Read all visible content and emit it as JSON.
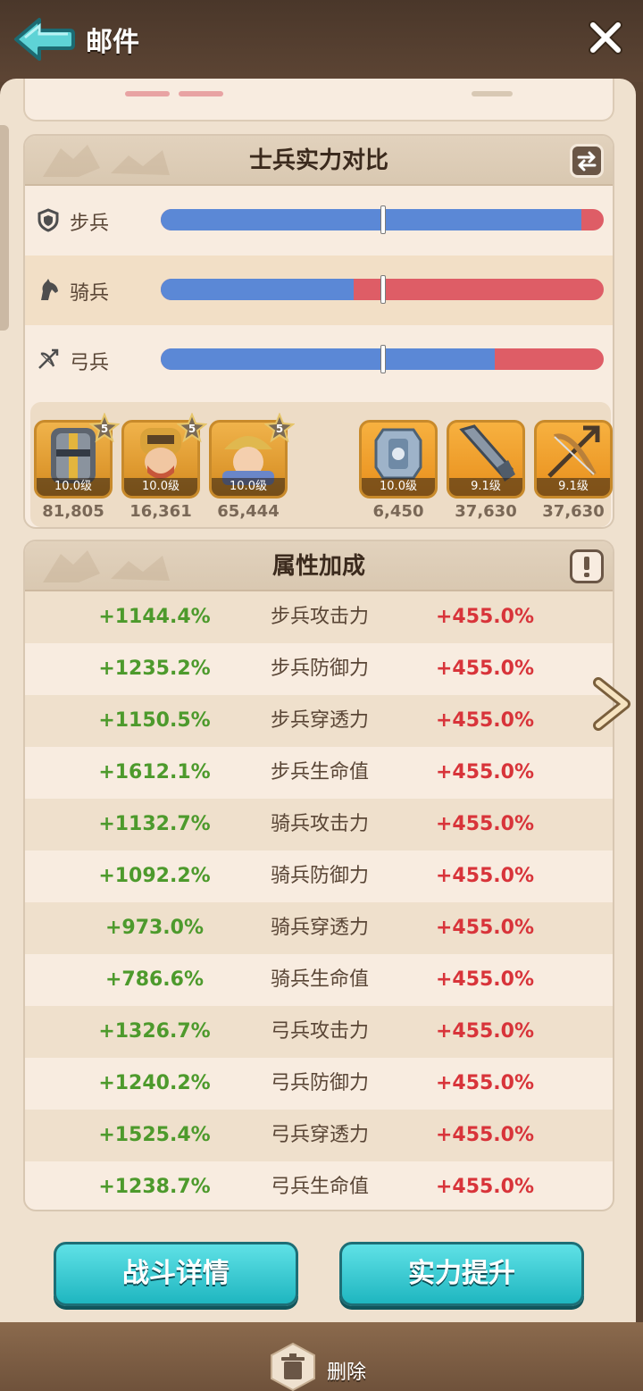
{
  "header": {
    "title": "邮件"
  },
  "comparison": {
    "title": "士兵实力对比",
    "rows": [
      {
        "label": "步兵",
        "icon": "shield-icon",
        "ratio": 0.95
      },
      {
        "label": "骑兵",
        "icon": "horse-icon",
        "ratio": 0.435
      },
      {
        "label": "弓兵",
        "icon": "crossbow-icon",
        "ratio": 0.755
      }
    ]
  },
  "units": [
    {
      "level": "10.0级",
      "stars": "5",
      "value": "81,805",
      "icon": "knight-helmet-portrait"
    },
    {
      "level": "10.0级",
      "stars": "5",
      "value": "16,361",
      "icon": "bearded-warrior-portrait"
    },
    {
      "level": "10.0级",
      "stars": "5",
      "value": "65,444",
      "icon": "young-soldier-portrait"
    },
    {
      "level": "10.0级",
      "value": "6,450",
      "icon": "shield-item-icon"
    },
    {
      "level": "9.1级",
      "value": "37,630",
      "icon": "spear-item-icon"
    },
    {
      "level": "9.1级",
      "value": "37,630",
      "icon": "crossbow-item-icon"
    }
  ],
  "attributes": {
    "title": "属性加成",
    "rows": [
      {
        "mine": "+1144.4%",
        "name": "步兵攻击力",
        "theirs": "+455.0%"
      },
      {
        "mine": "+1235.2%",
        "name": "步兵防御力",
        "theirs": "+455.0%"
      },
      {
        "mine": "+1150.5%",
        "name": "步兵穿透力",
        "theirs": "+455.0%"
      },
      {
        "mine": "+1612.1%",
        "name": "步兵生命值",
        "theirs": "+455.0%"
      },
      {
        "mine": "+1132.7%",
        "name": "骑兵攻击力",
        "theirs": "+455.0%"
      },
      {
        "mine": "+1092.2%",
        "name": "骑兵防御力",
        "theirs": "+455.0%"
      },
      {
        "mine": "+973.0%",
        "name": "骑兵穿透力",
        "theirs": "+455.0%"
      },
      {
        "mine": "+786.6%",
        "name": "骑兵生命值",
        "theirs": "+455.0%"
      },
      {
        "mine": "+1326.7%",
        "name": "弓兵攻击力",
        "theirs": "+455.0%"
      },
      {
        "mine": "+1240.2%",
        "name": "弓兵防御力",
        "theirs": "+455.0%"
      },
      {
        "mine": "+1525.4%",
        "name": "弓兵穿透力",
        "theirs": "+455.0%"
      },
      {
        "mine": "+1238.7%",
        "name": "弓兵生命值",
        "theirs": "+455.0%"
      }
    ]
  },
  "buttons": {
    "battle_details": "战斗详情",
    "power_up": "实力提升"
  },
  "footer": {
    "delete": "删除"
  },
  "colors": {
    "mine_bar": "#5b88d6",
    "enemy_bar": "#de5d66",
    "mine_value": "#4d9a2c",
    "enemy_value": "#d8343a",
    "button": "#1fb6c0"
  }
}
